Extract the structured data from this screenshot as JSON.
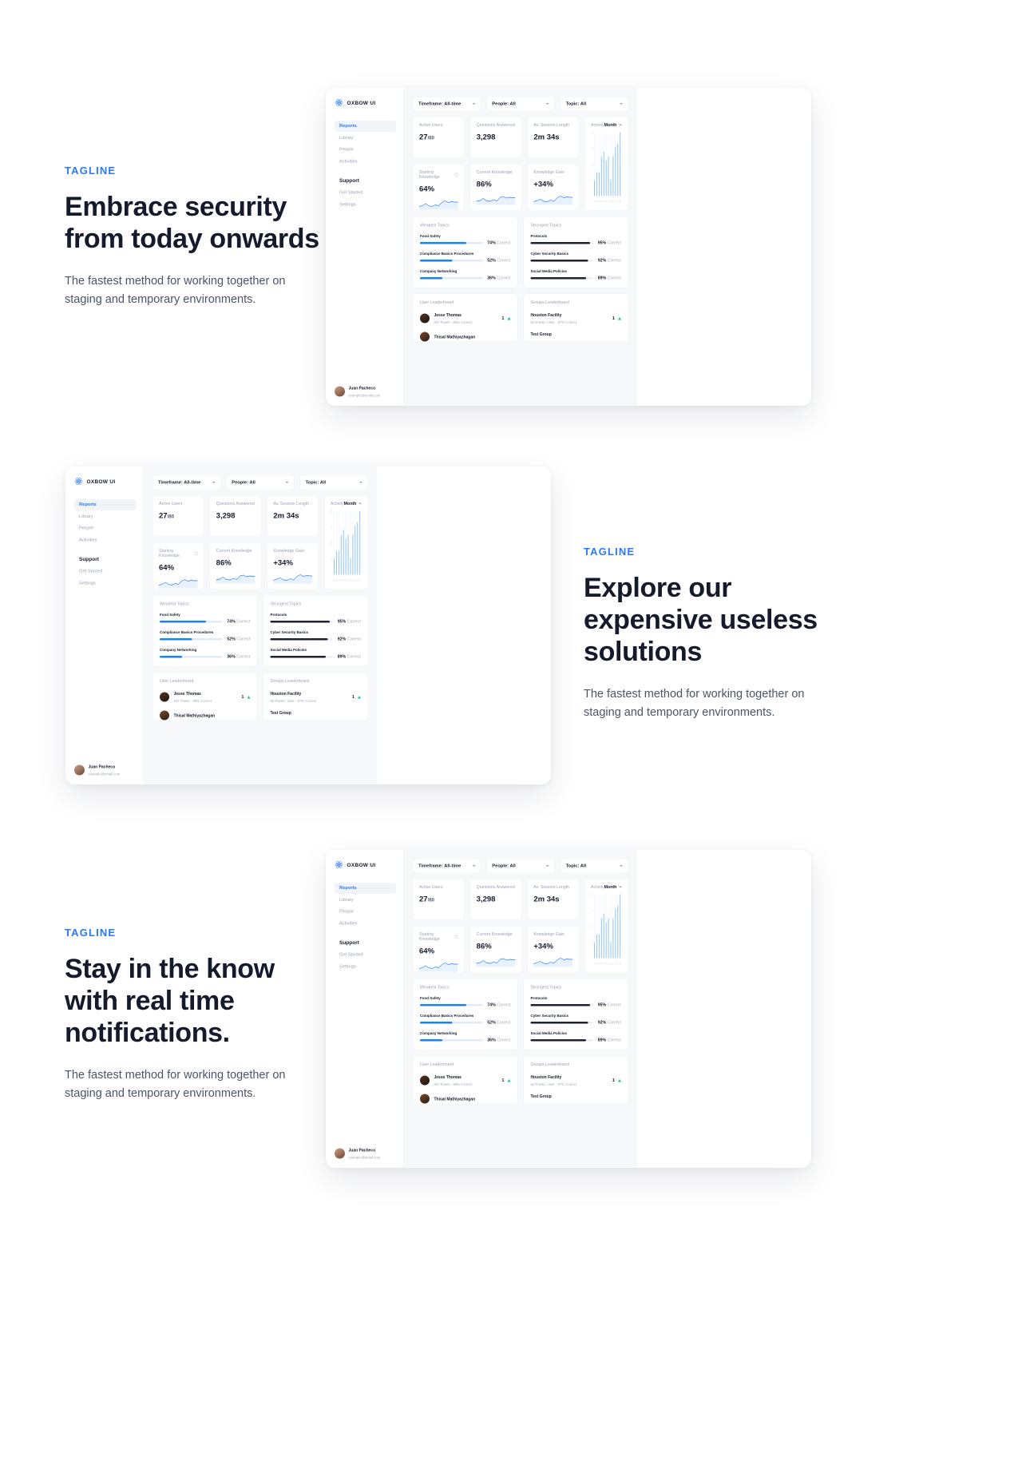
{
  "theme": {
    "accent": "#2979ff",
    "bar_blue": "#1784f5",
    "bar_dark": "#1d2235",
    "ink": "#151b2d",
    "muted": "#9aa3b4",
    "up": "#16c784"
  },
  "promos": [
    {
      "tagline": "TAGLINE",
      "headline": "Embrace security from today onwards",
      "body": "The fastest method for working together on staging and temporary environments."
    },
    {
      "tagline": "TAGLINE",
      "headline": "Explore our expensive useless solutions",
      "body": "The fastest method for working together on staging and temporary environments."
    },
    {
      "tagline": "TAGLINE",
      "headline": "Stay in the know with real time notifications.",
      "body": "The fastest method for working together on staging and temporary environments."
    }
  ],
  "app": {
    "brand": "OXBOW UI",
    "sidebar": {
      "items": [
        {
          "label": "Reports",
          "active": true
        },
        {
          "label": "Library",
          "active": false
        },
        {
          "label": "People",
          "active": false
        },
        {
          "label": "Activities",
          "active": false
        }
      ],
      "group_title": "Support",
      "group_items": [
        {
          "label": "Get Started"
        },
        {
          "label": "Settings"
        }
      ],
      "profile": {
        "name": "Juan Pacheco",
        "email": "example@email.com"
      }
    },
    "filters": [
      {
        "label": "Timeframe: All-time"
      },
      {
        "label": "People: All"
      },
      {
        "label": "Topic: All"
      }
    ],
    "stats": [
      {
        "title": "Active Users",
        "value": "27",
        "suffix": "/80"
      },
      {
        "title": "Questions Answered",
        "value": "3,298",
        "suffix": ""
      },
      {
        "title": "Av. Session Length",
        "value": "2m 34s",
        "suffix": ""
      }
    ],
    "knowledge": [
      {
        "title": "Starting Knowledge",
        "info": true,
        "value": "64%"
      },
      {
        "title": "Current Knowledge",
        "info": false,
        "value": "86%"
      },
      {
        "title": "Knowledge Gain",
        "info": false,
        "value": "+34%"
      }
    ],
    "activity": {
      "title": "Activity",
      "range_label": "Month"
    },
    "weakest": {
      "title": "Weakest Topics",
      "correct_label": "Correct",
      "items": [
        {
          "label": "Food Safety",
          "pct": 74,
          "value": "74%"
        },
        {
          "label": "Compliance Basics Procedures",
          "pct": 52,
          "value": "52%"
        },
        {
          "label": "Company Networking",
          "pct": 36,
          "value": "36%"
        }
      ]
    },
    "strongest": {
      "title": "Strongest Topics",
      "correct_label": "Correct",
      "items": [
        {
          "label": "Protocols",
          "pct": 95,
          "value": "95%"
        },
        {
          "label": "Cyber Security Basics",
          "pct": 92,
          "value": "92%"
        },
        {
          "label": "Social Media Policies",
          "pct": 89,
          "value": "89%"
        }
      ]
    },
    "user_leaderboard": {
      "title": "User Leaderboard",
      "entries": [
        {
          "name": "Jesse Thomas",
          "meta": "637 Points · 98% Correct",
          "rank": "1",
          "trend": "up"
        },
        {
          "name": "Thisal Mathiyazhagan",
          "meta": "",
          "rank": "",
          "trend": ""
        }
      ]
    },
    "groups_leaderboard": {
      "title": "Groups Leaderboard",
      "entries": [
        {
          "name": "Houston Facility",
          "meta": "52 Points / User · 97% Correct",
          "rank": "1",
          "trend": "up"
        },
        {
          "name": "Test Group",
          "meta": "",
          "rank": "",
          "trend": ""
        }
      ]
    }
  },
  "chart_data": {
    "type": "bar",
    "title": "Activity",
    "categories": [
      "JAN",
      "FEB",
      "MAR",
      "APR",
      "MAY",
      "JUN",
      "JUL",
      "AUG",
      "SEP",
      "OCT",
      "NOV",
      "DEC"
    ],
    "values": [
      100,
      150,
      150,
      250,
      280,
      225,
      250,
      105,
      250,
      310,
      330,
      400
    ],
    "ylabel": "",
    "xlabel": "",
    "ytick_labels": [
      "0",
      "100",
      "200",
      "300",
      "400"
    ],
    "ytick_values": [
      0,
      100,
      200,
      300,
      400
    ],
    "ylim": [
      0,
      400
    ],
    "grid": false,
    "series_color": "#1784f5",
    "track_color": "#eaf2fe",
    "legend": "Month"
  }
}
